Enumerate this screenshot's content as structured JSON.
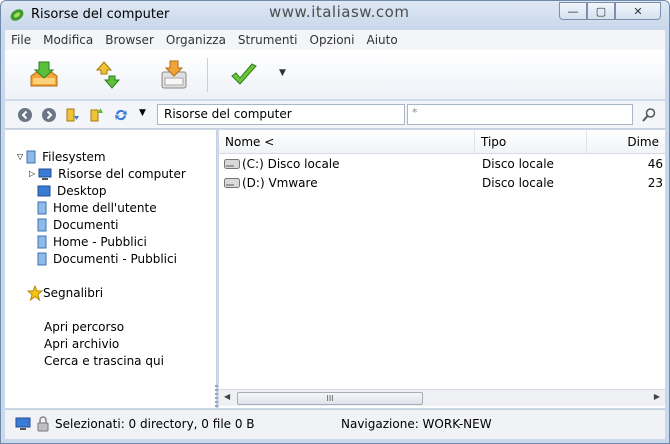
{
  "window": {
    "title": "Risorse del computer",
    "watermark": "www.italiasw.com",
    "buttons": {
      "minimize": "—",
      "maximize": "▢",
      "close": "✕"
    }
  },
  "menu": [
    "File",
    "Modifica",
    "Browser",
    "Organizza",
    "Strumenti",
    "Opzioni",
    "Aiuto"
  ],
  "address": {
    "path": "Risorse del computer",
    "filter": "*"
  },
  "tree": {
    "filesystem": "Filesystem",
    "items": [
      "Risorse del computer",
      "Desktop",
      "Home dell'utente",
      "Documenti",
      "Home - Pubblici",
      "Documenti - Pubblici"
    ],
    "bookmarks": "Segnalibri",
    "actions": [
      "Apri percorso",
      "Apri archivio",
      "Cerca e trascina qui"
    ]
  },
  "columns": {
    "name": "Nome <",
    "type": "Tipo",
    "size": "Dime"
  },
  "files": [
    {
      "name": "(C:) Disco locale",
      "type": "Disco locale",
      "size": "46"
    },
    {
      "name": "(D:) Vmware",
      "type": "Disco locale",
      "size": "23"
    }
  ],
  "scrollbar": {
    "grip": "III"
  },
  "status": {
    "selected": "Selezionati: 0 directory, 0 file 0 B",
    "navigation": "Navigazione: WORK-NEW"
  }
}
